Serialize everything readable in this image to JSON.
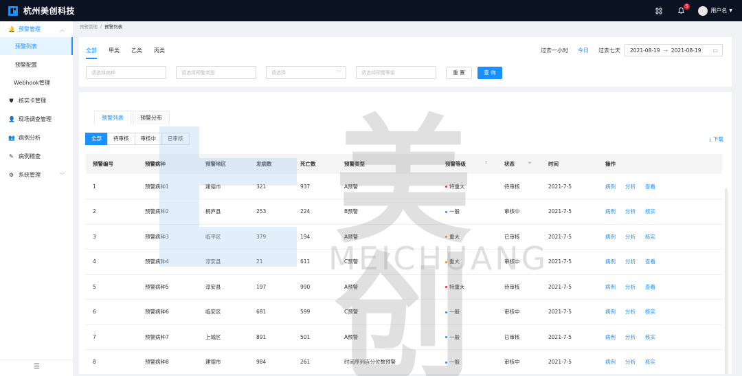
{
  "app": {
    "title": "杭州美创科技"
  },
  "topbar": {
    "notification_count": "5",
    "user_name": "用户名"
  },
  "sidebar": {
    "groups": [
      {
        "label": "预警管理",
        "icon": "bell-icon",
        "children": [
          "预警列表",
          "预警配置",
          "Webhook管理"
        ]
      }
    ],
    "items": [
      {
        "label": "核实卡管理",
        "icon": "shield-icon"
      },
      {
        "label": "现场调查管理",
        "icon": "people-icon"
      },
      {
        "label": "病例分析",
        "icon": "person-tree-icon"
      },
      {
        "label": "病例稽查",
        "icon": "pen-icon"
      },
      {
        "label": "系统管理",
        "icon": "gear-icon"
      }
    ],
    "active_item": "预警列表"
  },
  "breadcrumb": {
    "parent": "预警管理",
    "current": "预警列表"
  },
  "filter_panel": {
    "category_tabs": [
      "全部",
      "甲类",
      "乙类",
      "丙类"
    ],
    "active_category": "全部",
    "time_quick": [
      "过去一小时",
      "今日",
      "过去七天"
    ],
    "active_time": "今日",
    "date_start": "2021-08-19",
    "date_end": "2021-08-19",
    "placeholders": {
      "disease": "请选择病种",
      "warning_type": "请选择预警类型",
      "select": "请选择",
      "warning_level": "请选择预警等级"
    },
    "reset_label": "重 置",
    "query_label": "查 询"
  },
  "table_panel": {
    "view_tabs": [
      "预警列表",
      "预警分布"
    ],
    "active_view": "预警列表",
    "status_filters": [
      "全部",
      "待审核",
      "审核中",
      "已审核"
    ],
    "active_status": "全部",
    "download_label": "下载",
    "columns": [
      "预警编号",
      "预警病种",
      "预警地区",
      "发病数",
      "死亡数",
      "预警类型",
      "预警等级",
      "状态",
      "时间",
      "操作"
    ],
    "rows": [
      {
        "id": "1",
        "disease": "预警病种1",
        "region": "建德市",
        "cases": "321",
        "deaths": "937",
        "type": "A预警",
        "level": "特重大",
        "level_color": "#f5222d",
        "status": "待审核",
        "time": "2021-7-5",
        "actions": [
          "病例",
          "分析",
          "查看"
        ]
      },
      {
        "id": "2",
        "disease": "预警病种2",
        "region": "桐庐县",
        "cases": "253",
        "deaths": "224",
        "type": "B预警",
        "level": "一般",
        "level_color": "#1890ff",
        "status": "审核中",
        "time": "2021-7-5",
        "actions": [
          "病例",
          "分析",
          "核实"
        ]
      },
      {
        "id": "3",
        "disease": "预警病种3",
        "region": "临平区",
        "cases": "379",
        "deaths": "194",
        "type": "A预警",
        "level": "重大",
        "level_color": "#fa8c16",
        "status": "已审核",
        "time": "2021-7-5",
        "actions": [
          "病例",
          "分析",
          "核实"
        ]
      },
      {
        "id": "4",
        "disease": "预警病种4",
        "region": "淳安县",
        "cases": "21",
        "deaths": "611",
        "type": "C预警",
        "level": "重大",
        "level_color": "#fa8c16",
        "status": "审核中",
        "time": "2021-7-5",
        "actions": [
          "病例",
          "分析",
          "查看"
        ]
      },
      {
        "id": "5",
        "disease": "预警病种5",
        "region": "淳安县",
        "cases": "197",
        "deaths": "990",
        "type": "A预警",
        "level": "特重大",
        "level_color": "#f5222d",
        "status": "待审核",
        "time": "2021-7-5",
        "actions": [
          "病例",
          "分析",
          "查看"
        ]
      },
      {
        "id": "6",
        "disease": "预警病种6",
        "region": "临安区",
        "cases": "681",
        "deaths": "599",
        "type": "C预警",
        "level": "一般",
        "level_color": "#1890ff",
        "status": "审核中",
        "time": "2021-7-5",
        "actions": [
          "病例",
          "分析",
          "核实"
        ]
      },
      {
        "id": "7",
        "disease": "预警病种7",
        "region": "上城区",
        "cases": "891",
        "deaths": "501",
        "type": "A预警",
        "level": "一般",
        "level_color": "#1890ff",
        "status": "已审核",
        "time": "2021-7-5",
        "actions": [
          "病例",
          "分析",
          "核实"
        ]
      },
      {
        "id": "8",
        "disease": "预警病种8",
        "region": "建德市",
        "cases": "984",
        "deaths": "261",
        "type": "时间序列百分位数预警",
        "level": "一般",
        "level_color": "#1890ff",
        "status": "审核中",
        "time": "2021-7-5",
        "actions": [
          "病例",
          "分析",
          "核实"
        ]
      }
    ]
  },
  "watermark": {
    "brand": "美创",
    "brand_en": "MEICHUANG"
  },
  "colors": {
    "accent": "#1890ff",
    "topbar": "#0b1221"
  }
}
